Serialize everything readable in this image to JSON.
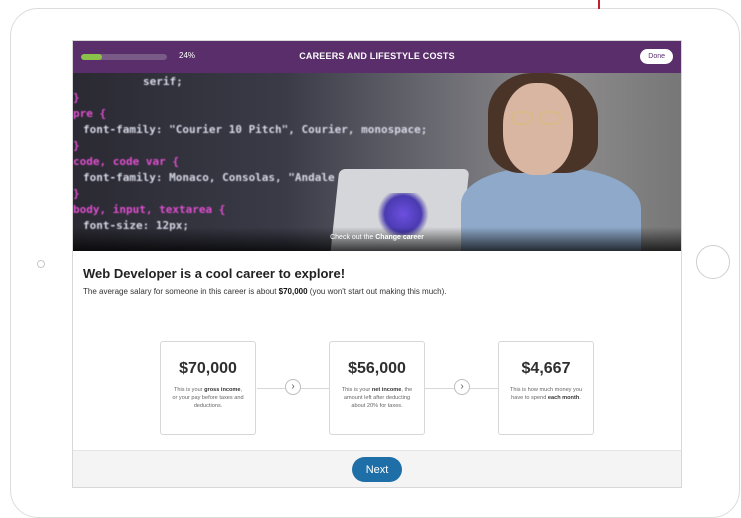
{
  "topbar": {
    "progress_percent": 24,
    "progress_label": "24%",
    "title": "CAREERS AND LIFESTYLE COSTS",
    "done_label": "Done",
    "background_color": "#5a2d6b",
    "progress_color": "#8bc34a"
  },
  "hero": {
    "code_lines": [
      "serif;",
      "}",
      "pre {",
      "  font-family: \"Courier 10 Pitch\", Courier, monospace;",
      "}",
      "code, code var {",
      "  font-family: Monaco, Consolas, \"Andale Mono\"",
      "}",
      "body, input, textarea {",
      "  font-size: 12px;"
    ],
    "caption_prefix": "Check out the ",
    "caption_link": "",
    "caption_change": "Change career"
  },
  "content": {
    "headline": "Web Developer is a cool career to explore!",
    "sub_prefix": "The average salary for someone in this career is about ",
    "sub_amount": "$70,000",
    "sub_suffix": " (you won't start out making this much)."
  },
  "cards": [
    {
      "amount": "$70,000",
      "desc_before": "This is your ",
      "desc_bold": "gross income",
      "desc_after": ", or your pay before taxes and deductions."
    },
    {
      "amount": "$56,000",
      "desc_before": "This is your ",
      "desc_bold": "net income",
      "desc_after": ", the amount left after deducting about 20% for taxes."
    },
    {
      "amount": "$4,667",
      "desc_before": "This is how much money you have to spend ",
      "desc_bold": "each month",
      "desc_after": "."
    }
  ],
  "arrows": [
    {
      "icon": "chevron-right-icon",
      "glyph": "›"
    },
    {
      "icon": "chevron-right-icon",
      "glyph": "›"
    }
  ],
  "footer": {
    "next_label": "Next",
    "next_color": "#1e6fa8"
  }
}
